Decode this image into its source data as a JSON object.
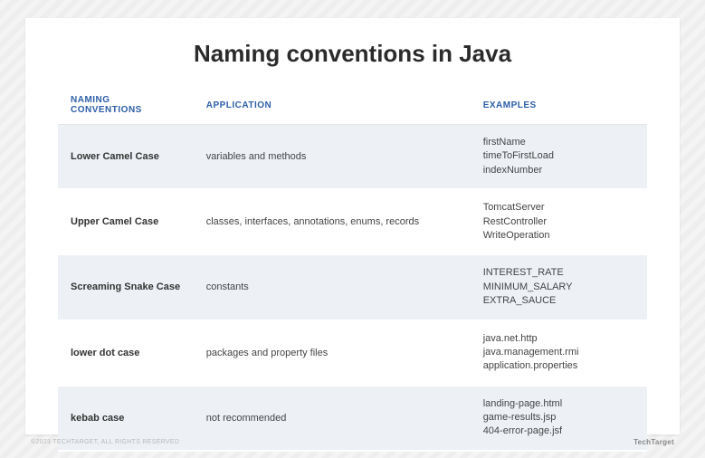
{
  "title": "Naming conventions in Java",
  "columns": {
    "c1": "NAMING CONVENTIONS",
    "c2": "APPLICATION",
    "c3": "EXAMPLES"
  },
  "rows": [
    {
      "name": "Lower Camel Case",
      "application": "variables and methods",
      "examples": "firstName\ntimeToFirstLoad\nindexNumber"
    },
    {
      "name": "Upper Camel Case",
      "application": "classes, interfaces, annotations, enums, records",
      "examples": "TomcatServer\nRestController\nWriteOperation"
    },
    {
      "name": "Screaming Snake Case",
      "application": "constants",
      "examples": "INTEREST_RATE\nMINIMUM_SALARY\nEXTRA_SAUCE"
    },
    {
      "name": "lower dot case",
      "application": "packages and property files",
      "examples": "java.net.http\njava.management.rmi\napplication.properties"
    },
    {
      "name": "kebab case",
      "application": "not recommended",
      "examples": "landing-page.html\ngame-results.jsp\n404-error-page.jsf"
    }
  ],
  "footer": {
    "copyright": "©2023 TECHTARGET, ALL RIGHTS RESERVED",
    "brand": "TechTarget"
  }
}
